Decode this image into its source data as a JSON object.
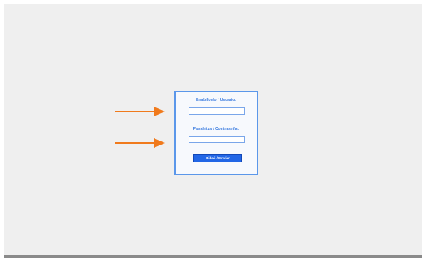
{
  "login": {
    "username_label": "Enabifuelo / Usuario:",
    "username_value": "",
    "password_label": "Pasahitza / Contraseña:",
    "password_value": "",
    "submit_label": "Bidali / Enviar"
  },
  "annotations": {
    "arrow_icon": "arrow-right-icon",
    "arrow_color": "#f07a1c"
  },
  "colors": {
    "background": "#efefef",
    "panel_border": "#5b97ea",
    "label_text": "#3d7de0",
    "button": "#2266e6"
  }
}
